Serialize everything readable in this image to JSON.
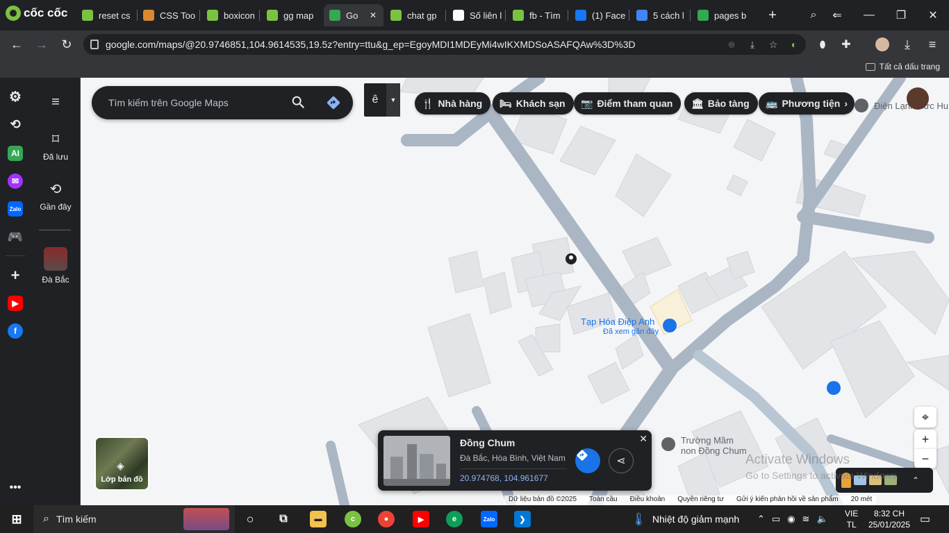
{
  "browser": {
    "brand": "cốc cốc",
    "tabs": [
      {
        "title": "reset cs",
        "color": "#7bc242"
      },
      {
        "title": "CSS Too",
        "color": "#d88a2f"
      },
      {
        "title": "boxicon",
        "color": "#7bc242"
      },
      {
        "title": "gg map",
        "color": "#7bc242"
      },
      {
        "title": "Go",
        "color": "#34a853"
      },
      {
        "title": "chat gp",
        "color": "#7bc242"
      },
      {
        "title": "Số liên l",
        "color": "#ffffff"
      },
      {
        "title": "fb - Tìm",
        "color": "#7bc242"
      },
      {
        "title": "(1) Face",
        "color": "#1877f2"
      },
      {
        "title": "5 cách l",
        "color": "#4285f4"
      },
      {
        "title": "pages b",
        "color": "#34a853"
      }
    ],
    "url": "google.com/maps/@20.9746851,104.9614535,19.5z?entry=ttu&g_ep=EgoyMDI1MDEyMi4wIKXMDSoASAFQAw%3D%3D",
    "bookmarks_all": "Tất cả dấu trang"
  },
  "maps": {
    "search_placeholder": "Tìm kiếm trên Google Maps",
    "ime_char": "ê",
    "sidebar": {
      "saved": "Đã lưu",
      "recent": "Gần đây",
      "place": "Đà Bắc"
    },
    "chips": [
      "Nhà hàng",
      "Khách sạn",
      "Điểm tham quan",
      "Bảo tàng",
      "Phương tiện"
    ],
    "poi": {
      "electric": "Điện Lạnh Sức Hu",
      "store_name": "Tạp Hóa Điệp Anh",
      "store_sub": "Đã xem gần đây",
      "school_line1": "Trường Mầm",
      "school_line2": "non Đồng Chum"
    },
    "layers_label": "Lớp bản đồ",
    "card": {
      "title": "Đồng Chum",
      "address": "Đà Bắc, Hòa Bình, Việt Nam",
      "coords": "20.974768, 104.961677"
    },
    "footer": [
      "Dữ liệu bản đồ ©2025",
      "Toàn cầu",
      "Điều khoản",
      "Quyền riêng tư",
      "Gửi ý kiến phản hồi về sản phẩm",
      "20 mét"
    ]
  },
  "watermark": {
    "line1": "Activate Windows",
    "line2": "Go to Settings to activate Windows."
  },
  "taskbar": {
    "search": "Tìm kiếm",
    "weather": "Nhiệt độ giảm mạnh",
    "lang1": "VIE",
    "lang2": "TL",
    "time": "8:32 CH",
    "date": "25/01/2025"
  }
}
